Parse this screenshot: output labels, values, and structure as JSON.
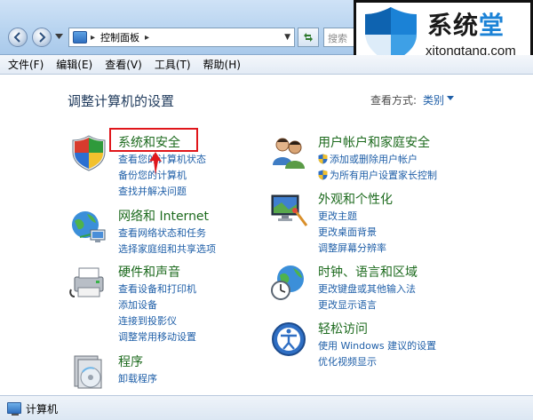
{
  "window": {
    "address_path": "控制面板",
    "search_placeholder": "搜索"
  },
  "watermark": {
    "brand_main": "系统",
    "brand_accent": "堂",
    "brand_url": "xitongtang.com",
    "accent_color": "#1b82d6"
  },
  "menu": [
    {
      "label": "文件(F)"
    },
    {
      "label": "编辑(E)"
    },
    {
      "label": "查看(V)"
    },
    {
      "label": "工具(T)"
    },
    {
      "label": "帮助(H)"
    }
  ],
  "main": {
    "title": "调整计算机的设置",
    "view_by_label": "查看方式:",
    "view_by_value": "类别"
  },
  "categories": {
    "system_security": {
      "title": "系统和安全",
      "icon": "shield-icon",
      "links": [
        "查看您的计算机状态",
        "备份您的计算机",
        "查找并解决问题"
      ]
    },
    "network": {
      "title": "网络和 Internet",
      "icon": "globe-network-icon",
      "links": [
        "查看网络状态和任务",
        "选择家庭组和共享选项"
      ]
    },
    "hardware": {
      "title": "硬件和声音",
      "icon": "printer-icon",
      "links": [
        "查看设备和打印机",
        "添加设备",
        "连接到投影仪",
        "调整常用移动设置"
      ]
    },
    "programs": {
      "title": "程序",
      "icon": "programs-disc-icon",
      "links": [
        "卸载程序"
      ]
    },
    "user_accounts": {
      "title": "用户帐户和家庭安全",
      "icon": "users-icon",
      "links": [
        "添加或删除用户帐户",
        "为所有用户设置家长控制"
      ]
    },
    "appearance": {
      "title": "外观和个性化",
      "icon": "monitor-palette-icon",
      "links": [
        "更改主题",
        "更改桌面背景",
        "调整屏幕分辨率"
      ]
    },
    "clock_region": {
      "title": "时钟、语言和区域",
      "icon": "clock-globe-icon",
      "links": [
        "更改键盘或其他输入法",
        "更改显示语言"
      ]
    },
    "ease_access": {
      "title": "轻松访问",
      "icon": "ease-of-access-icon",
      "links": [
        "使用 Windows 建议的设置",
        "优化视频显示"
      ]
    }
  },
  "status": {
    "text": "计算机"
  },
  "colors": {
    "category_title": "#1c6a1d",
    "link": "#1f5fa8",
    "highlight": "#e0161b"
  }
}
